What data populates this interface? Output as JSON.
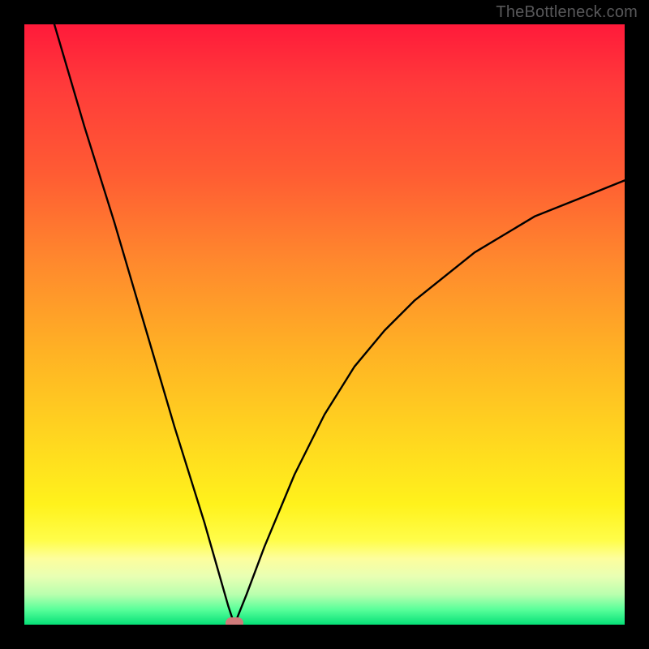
{
  "watermark": "TheBottleneck.com",
  "chart_data": {
    "type": "line",
    "title": "",
    "xlabel": "",
    "ylabel": "",
    "xlim": [
      0,
      100
    ],
    "ylim": [
      0,
      100
    ],
    "background_gradient": {
      "top": "#ff1a3a",
      "bottom": "#06e077",
      "meaning": "red=high bottleneck, green=low bottleneck"
    },
    "series": [
      {
        "name": "bottleneck-curve",
        "stroke": "#000000",
        "x": [
          5,
          10,
          15,
          20,
          25,
          30,
          32,
          34,
          35,
          37,
          40,
          45,
          50,
          55,
          60,
          65,
          70,
          75,
          80,
          85,
          90,
          95,
          100
        ],
        "y": [
          100,
          83,
          67,
          50,
          33,
          17,
          10,
          3,
          0,
          5,
          13,
          25,
          35,
          43,
          49,
          54,
          58,
          62,
          65,
          68,
          70,
          72,
          74
        ]
      }
    ],
    "optimum_marker": {
      "x": 35,
      "y": 0,
      "color": "#cf7a7a"
    }
  }
}
